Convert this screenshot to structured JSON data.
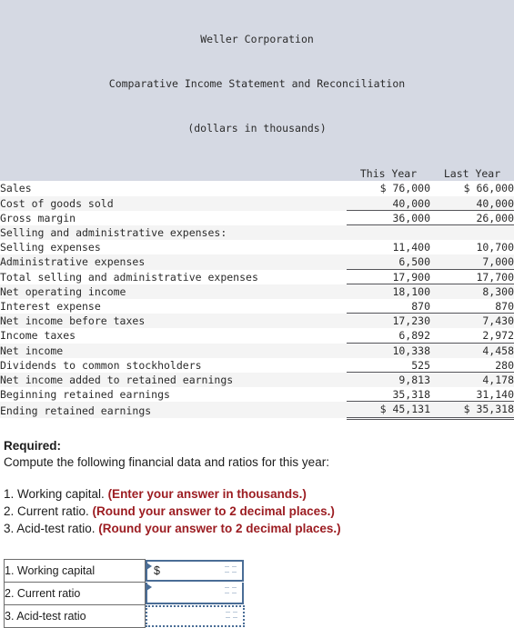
{
  "statement": {
    "title_lines": [
      "Weller Corporation",
      "Comparative Income Statement and Reconciliation",
      "(dollars in thousands)"
    ],
    "columns": [
      "",
      "This Year",
      "Last Year"
    ],
    "rows": [
      {
        "label": "Sales",
        "this_year": "$ 76,000",
        "last_year": "$ 66,000",
        "rule": "none",
        "indent": 0
      },
      {
        "label": "Cost of goods sold",
        "this_year": "40,000",
        "last_year": "40,000",
        "rule": "single",
        "indent": 0
      },
      {
        "label": "Gross margin",
        "this_year": "36,000",
        "last_year": "26,000",
        "rule": "single",
        "indent": 0
      },
      {
        "label": "Selling and administrative expenses:",
        "this_year": "",
        "last_year": "",
        "rule": "none",
        "indent": 0
      },
      {
        "label": "Selling expenses",
        "this_year": "11,400",
        "last_year": "10,700",
        "rule": "none",
        "indent": 1
      },
      {
        "label": "Administrative expenses",
        "this_year": "6,500",
        "last_year": "7,000",
        "rule": "single",
        "indent": 1
      },
      {
        "label": "Total selling and administrative expenses",
        "this_year": "17,900",
        "last_year": "17,700",
        "rule": "single",
        "indent": 0
      },
      {
        "label": "Net operating income",
        "this_year": "18,100",
        "last_year": "8,300",
        "rule": "none",
        "indent": 0
      },
      {
        "label": "Interest expense",
        "this_year": "870",
        "last_year": "870",
        "rule": "single",
        "indent": 0
      },
      {
        "label": "Net income before taxes",
        "this_year": "17,230",
        "last_year": "7,430",
        "rule": "none",
        "indent": 0
      },
      {
        "label": "Income taxes",
        "this_year": "6,892",
        "last_year": "2,972",
        "rule": "single",
        "indent": 0
      },
      {
        "label": "Net income",
        "this_year": "10,338",
        "last_year": "4,458",
        "rule": "none",
        "indent": 0
      },
      {
        "label": "Dividends to common stockholders",
        "this_year": "525",
        "last_year": "280",
        "rule": "single",
        "indent": 0
      },
      {
        "label": "Net income added to retained earnings",
        "this_year": "9,813",
        "last_year": "4,178",
        "rule": "none",
        "indent": 0
      },
      {
        "label": "Beginning retained earnings",
        "this_year": "35,318",
        "last_year": "31,140",
        "rule": "single",
        "indent": 0
      },
      {
        "label": "Ending retained earnings",
        "this_year": "$ 45,131",
        "last_year": "$ 35,318",
        "rule": "double",
        "indent": 0
      }
    ]
  },
  "required": {
    "heading": "Required:",
    "subtitle": "Compute the following financial data and ratios for this year:",
    "items": [
      {
        "text": "1. Working capital. ",
        "note": "(Enter your answer in thousands.)"
      },
      {
        "text": "2. Current ratio. ",
        "note": "(Round your answer to 2 decimal places.)"
      },
      {
        "text": "3. Acid-test ratio. ",
        "note": "(Round your answer to 2 decimal places.)"
      }
    ],
    "note_color": "#9c1d22"
  },
  "answers": {
    "rows": [
      {
        "label": "1. Working capital",
        "prefix": "$",
        "value": "",
        "border": "solid"
      },
      {
        "label": "2. Current ratio",
        "prefix": "",
        "value": "",
        "border": "solid-mid"
      },
      {
        "label": "3. Acid-test ratio",
        "prefix": "",
        "value": "",
        "border": "dotted"
      }
    ]
  }
}
